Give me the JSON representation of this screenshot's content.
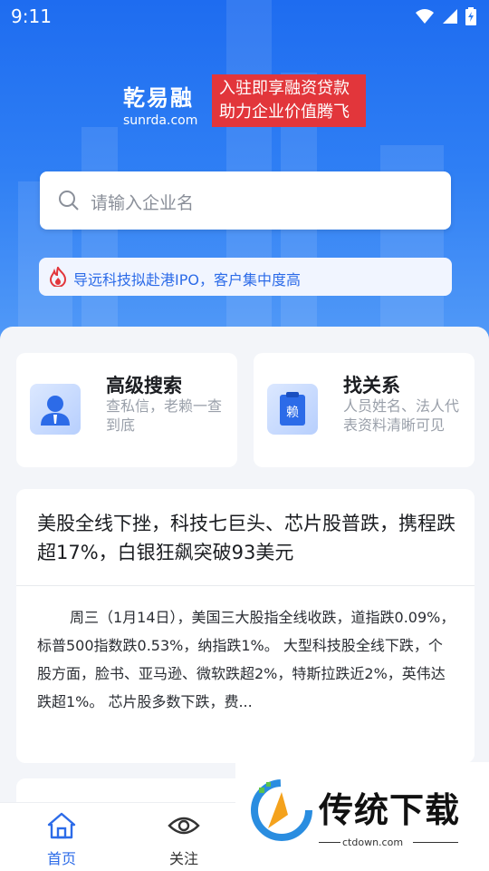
{
  "status_bar": {
    "time": "9:11"
  },
  "brand": {
    "name": "乾易融",
    "domain": "sunrda.com",
    "slogan_line1": "入驻即享融资贷款",
    "slogan_line2": "助力企业价值腾飞"
  },
  "search": {
    "placeholder": "请输入企业名"
  },
  "news_ticker": {
    "text": "导远科技拟赴港IPO，客户集中度高"
  },
  "features": [
    {
      "title": "高级搜索",
      "desc": "查私信，老赖一查到底",
      "icon": "person-icon"
    },
    {
      "title": "找关系",
      "desc": "人员姓名、法人代表资料清晰可见",
      "icon": "clipboard-icon",
      "badge": "赖"
    }
  ],
  "article": {
    "title": "美股全线下挫，科技七巨头、芯片股普跌，携程跌超17%，白银狂飙突破93美元",
    "body": "周三（1月14日），美国三大股指全线收跌，道指跌0.09%，标普500指数跌0.53%，纳指跌1%。 大型科技股全线下跌，个股方面，脸书、亚马逊、微软跌超2%，特斯拉跌近2%，英伟达跌超1%。 芯片股多数下跌，费..."
  },
  "tabbar": {
    "tabs": [
      {
        "label": "首页",
        "active": true
      },
      {
        "label": "关注",
        "active": false
      }
    ]
  },
  "watermark": {
    "text": "传统下载",
    "url": "ctdown.com"
  },
  "colors": {
    "accent": "#2c6be8",
    "slogan_bg": "#e2363b",
    "hero": "#1e6cf0"
  }
}
